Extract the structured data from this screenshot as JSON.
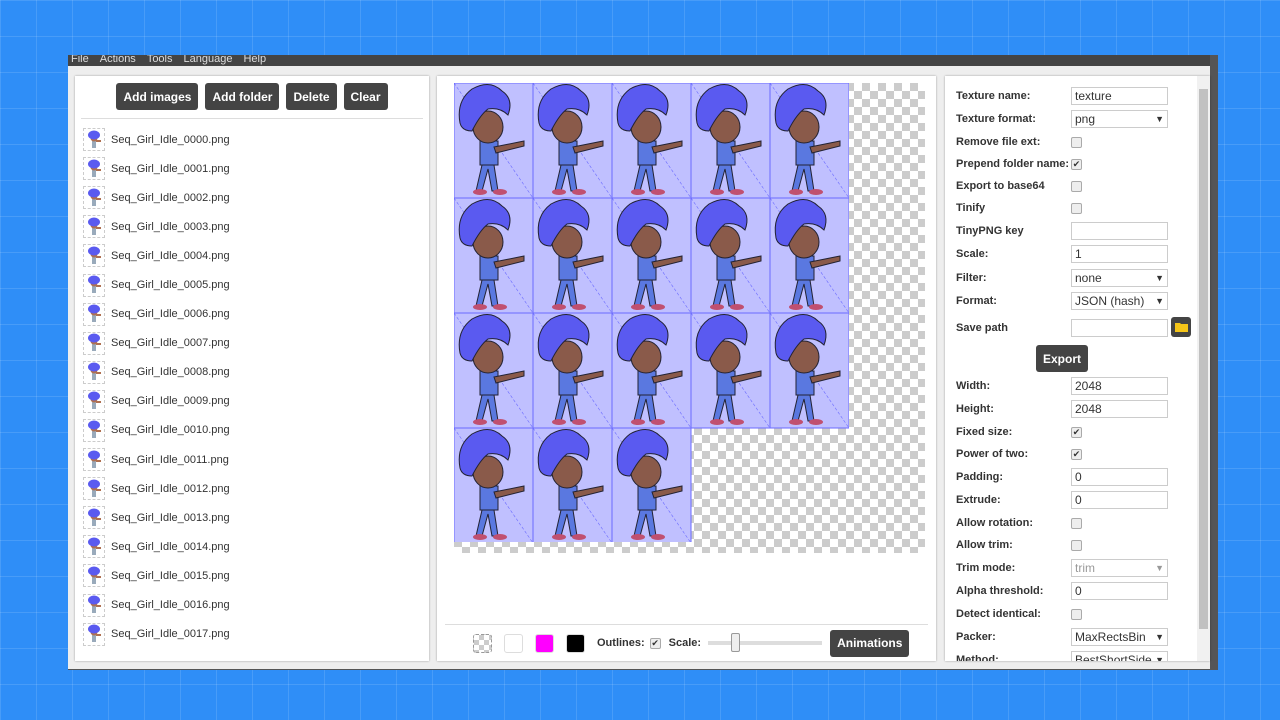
{
  "menu": [
    "File",
    "Actions",
    "Tools",
    "Language",
    "Help"
  ],
  "left": {
    "buttons": [
      "Add images",
      "Add folder",
      "Delete",
      "Clear"
    ],
    "files": [
      "Seq_Girl_Idle_0000.png",
      "Seq_Girl_Idle_0001.png",
      "Seq_Girl_Idle_0002.png",
      "Seq_Girl_Idle_0003.png",
      "Seq_Girl_Idle_0004.png",
      "Seq_Girl_Idle_0005.png",
      "Seq_Girl_Idle_0006.png",
      "Seq_Girl_Idle_0007.png",
      "Seq_Girl_Idle_0008.png",
      "Seq_Girl_Idle_0009.png",
      "Seq_Girl_Idle_0010.png",
      "Seq_Girl_Idle_0011.png",
      "Seq_Girl_Idle_0012.png",
      "Seq_Girl_Idle_0013.png",
      "Seq_Girl_Idle_0014.png",
      "Seq_Girl_Idle_0015.png",
      "Seq_Girl_Idle_0016.png",
      "Seq_Girl_Idle_0017.png"
    ]
  },
  "sheet": {
    "sprite_count": 18,
    "columns": 5,
    "colors": {
      "tint": "#c0c0ff",
      "hair": "#5a5af0",
      "skin": "#8a5a4a",
      "body": "#5a78e0",
      "outline": "#6a6aff"
    }
  },
  "toolbar": {
    "swatches": [
      "checker",
      "#ffffff",
      "#ff00ff",
      "#000000"
    ],
    "outlines_label": "Outlines:",
    "outlines_checked": true,
    "scale_label": "Scale:",
    "scale_value": 0.2,
    "animations_label": "Animations"
  },
  "settings": [
    {
      "label": "Texture name:",
      "type": "text",
      "value": "texture"
    },
    {
      "label": "Texture format:",
      "type": "select",
      "value": "png"
    },
    {
      "label": "Remove file ext:",
      "type": "checkbox",
      "checked": false
    },
    {
      "label": "Prepend folder name:",
      "type": "checkbox",
      "checked": true
    },
    {
      "label": "Export to base64",
      "type": "checkbox",
      "checked": false
    },
    {
      "label": "Tinify",
      "type": "checkbox",
      "checked": false
    },
    {
      "label": "TinyPNG key",
      "type": "text",
      "value": ""
    },
    {
      "label": "Scale:",
      "type": "text",
      "value": "1"
    },
    {
      "label": "Filter:",
      "type": "select",
      "value": "none"
    },
    {
      "label": "Format:",
      "type": "select",
      "value": "JSON (hash)"
    },
    {
      "label": "Save path",
      "type": "path",
      "value": ""
    },
    {
      "label": "Export",
      "type": "button"
    },
    {
      "label": "Width:",
      "type": "text",
      "value": "2048"
    },
    {
      "label": "Height:",
      "type": "text",
      "value": "2048"
    },
    {
      "label": "Fixed size:",
      "type": "checkbox",
      "checked": true
    },
    {
      "label": "Power of two:",
      "type": "checkbox",
      "checked": true
    },
    {
      "label": "Padding:",
      "type": "text",
      "value": "0"
    },
    {
      "label": "Extrude:",
      "type": "text",
      "value": "0"
    },
    {
      "label": "Allow rotation:",
      "type": "checkbox",
      "checked": false
    },
    {
      "label": "Allow trim:",
      "type": "checkbox",
      "checked": false
    },
    {
      "label": "Trim mode:",
      "type": "select",
      "value": "trim",
      "disabled": true
    },
    {
      "label": "Alpha threshold:",
      "type": "text",
      "value": "0"
    },
    {
      "label": "Detect identical:",
      "type": "checkbox",
      "checked": false
    },
    {
      "label": "Packer:",
      "type": "select",
      "value": "MaxRectsBin"
    },
    {
      "label": "Method:",
      "type": "select",
      "value": "BestShortSide"
    }
  ]
}
